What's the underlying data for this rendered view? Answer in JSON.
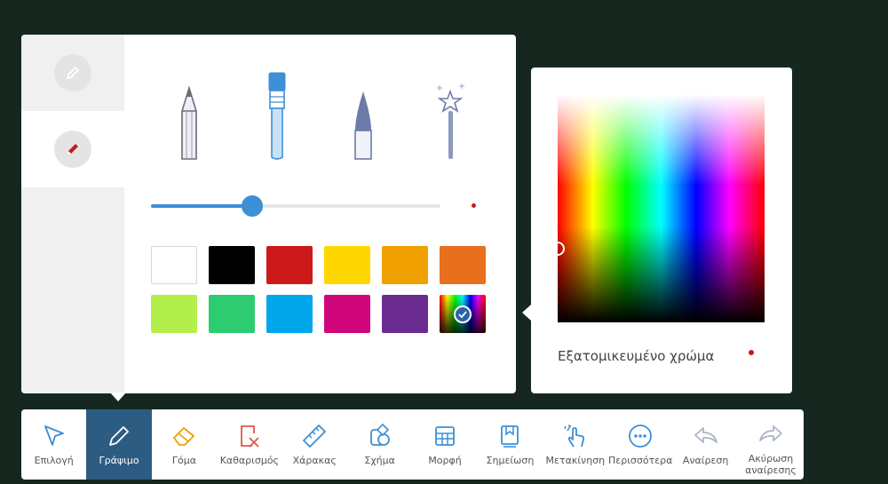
{
  "pen_panel": {
    "side_tabs": [
      {
        "name": "pen-settings",
        "icon": "pen-icon"
      },
      {
        "name": "highlighter-settings",
        "icon": "highlighter-icon"
      }
    ],
    "tools": [
      {
        "name": "pencil",
        "icon": "pencil-icon"
      },
      {
        "name": "brush",
        "icon": "paint-brush-icon"
      },
      {
        "name": "calligraphy-pen",
        "icon": "calligraphy-pen-icon"
      },
      {
        "name": "magic-pen",
        "icon": "magic-wand-icon"
      }
    ],
    "thickness_fraction": 0.35,
    "selected_color": "#c61a1a",
    "colors": [
      "#ffffff",
      "#000000",
      "#cc1a1a",
      "#ffd700",
      "#f0a000",
      "#e8701c",
      "#b2ef4b",
      "#2ecc71",
      "#00a6e9",
      "#d1067a",
      "#6a2c91",
      "custom"
    ]
  },
  "color_picker": {
    "label": "Εξατομικευμένο χρώμα",
    "current_color": "#c61a1a"
  },
  "toolbar": {
    "items": [
      {
        "label": "Επιλογή",
        "icon": "select-cursor-icon"
      },
      {
        "label": "Γράψιμο",
        "icon": "pen-icon"
      },
      {
        "label": "Γόμα",
        "icon": "eraser-icon"
      },
      {
        "label": "Καθαρισμός",
        "icon": "clear-page-icon"
      },
      {
        "label": "Χάρακας",
        "icon": "ruler-icon"
      },
      {
        "label": "Σχήμα",
        "icon": "shape-icon"
      },
      {
        "label": "Μορφή",
        "icon": "table-icon"
      },
      {
        "label": "Σημείωση",
        "icon": "bookmark-note-icon"
      },
      {
        "label": "Μετακίνηση",
        "icon": "hand-move-icon"
      },
      {
        "label": "Περισσότερα",
        "icon": "more-icon"
      },
      {
        "label": "Αναίρεση",
        "icon": "undo-icon"
      },
      {
        "label": "Ακύρωση\nαναίρεσης",
        "icon": "redo-icon"
      }
    ],
    "active_index": 1
  }
}
